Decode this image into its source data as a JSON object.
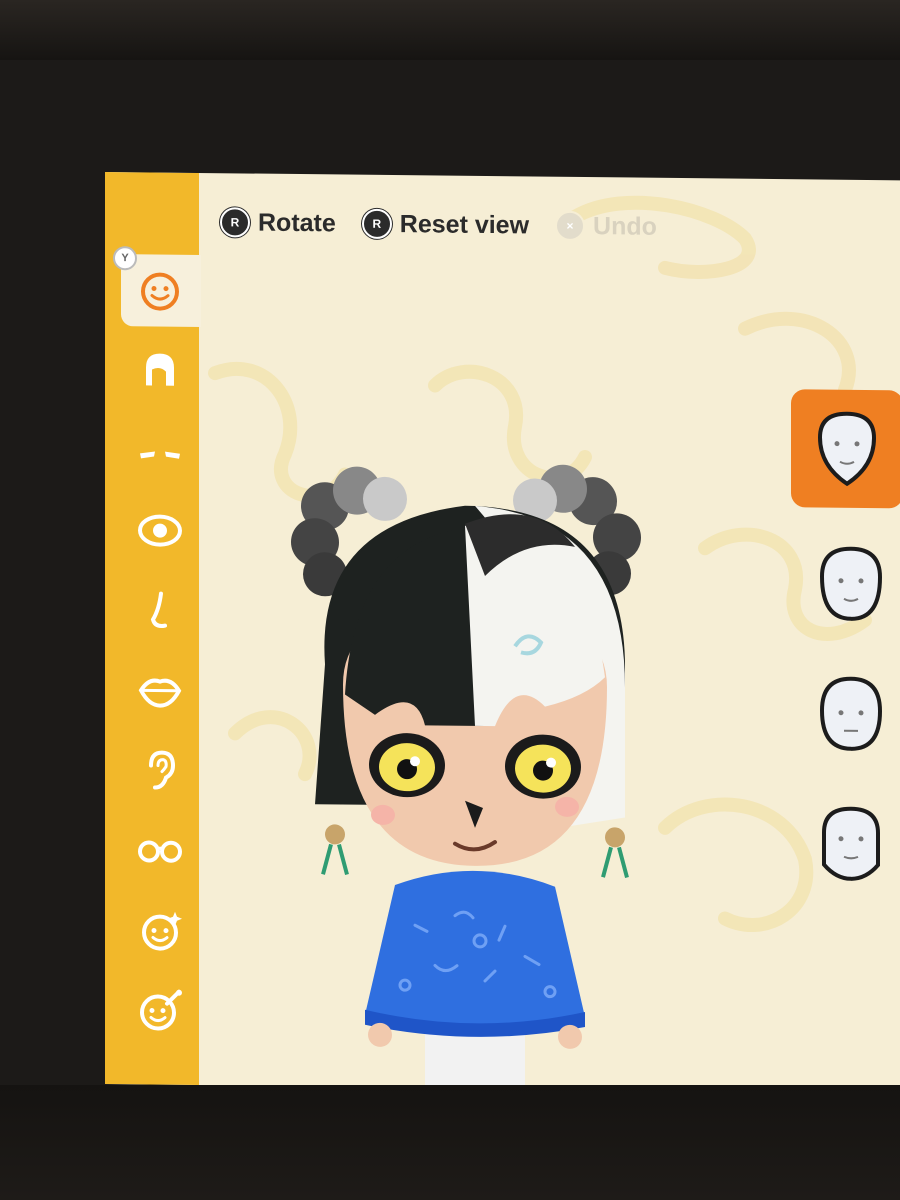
{
  "toolbar": {
    "rotate": {
      "button": "R",
      "label": "Rotate"
    },
    "reset_view": {
      "button": "R",
      "label": "Reset view"
    },
    "undo": {
      "button": "×",
      "label": "Undo",
      "enabled": false
    }
  },
  "sidebar": {
    "badge": "Y",
    "active_index": 0,
    "items": [
      {
        "icon": "face-icon"
      },
      {
        "icon": "hair-icon"
      },
      {
        "icon": "eyebrows-icon"
      },
      {
        "icon": "eye-icon"
      },
      {
        "icon": "nose-icon"
      },
      {
        "icon": "mouth-icon"
      },
      {
        "icon": "ear-icon"
      },
      {
        "icon": "glasses-icon"
      },
      {
        "icon": "face-paint-icon"
      },
      {
        "icon": "makeup-icon"
      }
    ]
  },
  "face_shapes": {
    "selected_index": 0,
    "items": [
      {
        "icon": "face-shape-1-icon"
      },
      {
        "icon": "face-shape-2-icon"
      },
      {
        "icon": "face-shape-3-icon"
      },
      {
        "icon": "face-shape-4-icon"
      }
    ]
  },
  "colors": {
    "sidebar": "#f2b82a",
    "background": "#f6eed5",
    "selection": "#ef7f22"
  }
}
